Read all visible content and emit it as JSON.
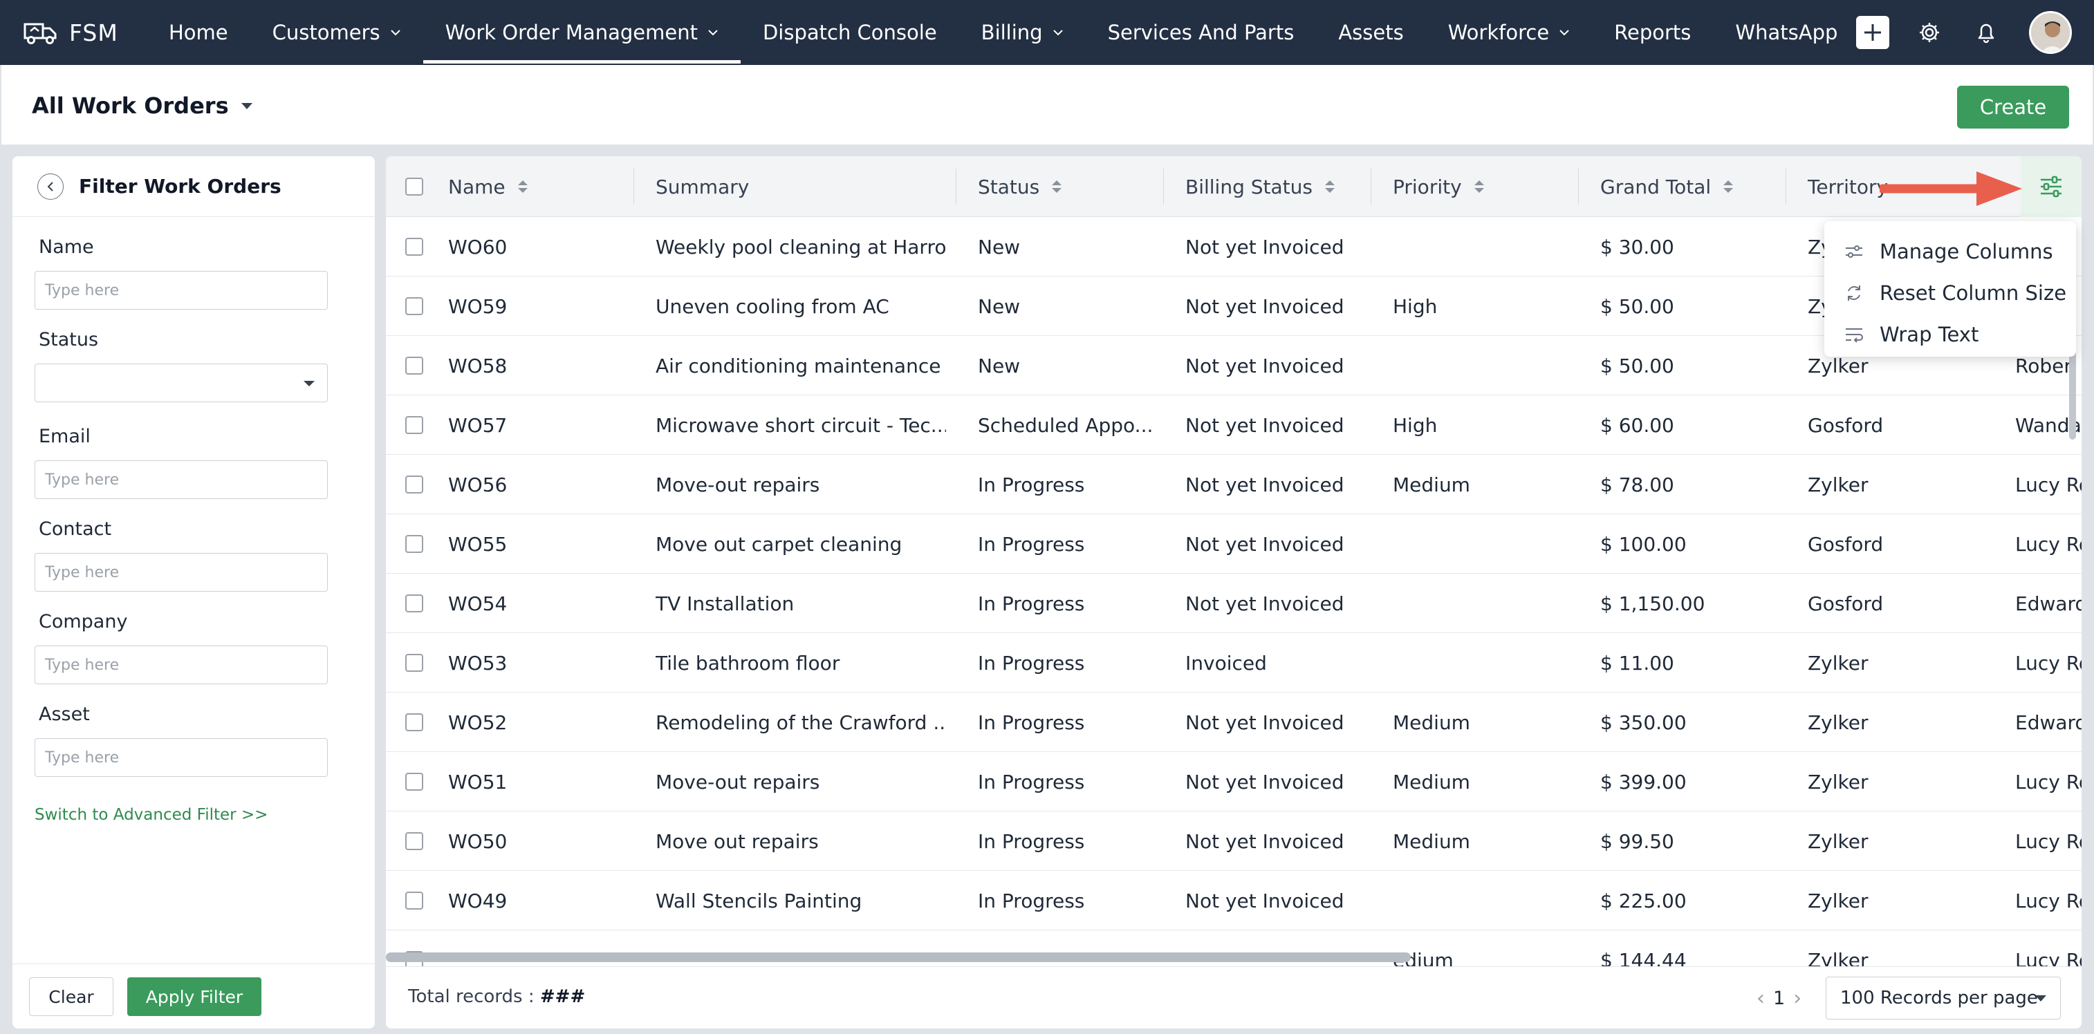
{
  "brand": {
    "name": "FSM"
  },
  "nav": [
    {
      "label": "Home",
      "dropdown": false,
      "active": false
    },
    {
      "label": "Customers",
      "dropdown": true,
      "active": false
    },
    {
      "label": "Work Order Management",
      "dropdown": true,
      "active": true
    },
    {
      "label": "Dispatch Console",
      "dropdown": false,
      "active": false
    },
    {
      "label": "Billing",
      "dropdown": true,
      "active": false
    },
    {
      "label": "Services And Parts",
      "dropdown": false,
      "active": false
    },
    {
      "label": "Assets",
      "dropdown": false,
      "active": false
    },
    {
      "label": "Workforce",
      "dropdown": true,
      "active": false
    },
    {
      "label": "Reports",
      "dropdown": false,
      "active": false
    },
    {
      "label": "WhatsApp",
      "dropdown": false,
      "active": false
    }
  ],
  "header": {
    "title": "All Work Orders",
    "create_label": "Create"
  },
  "filter": {
    "title": "Filter Work Orders",
    "fields": [
      {
        "label": "Name",
        "type": "text",
        "placeholder": "Type here"
      },
      {
        "label": "Status",
        "type": "select",
        "placeholder": ""
      },
      {
        "label": "Email",
        "type": "text",
        "placeholder": "Type here"
      },
      {
        "label": "Contact",
        "type": "text",
        "placeholder": "Type here"
      },
      {
        "label": "Company",
        "type": "text",
        "placeholder": "Type here"
      },
      {
        "label": "Asset",
        "type": "text",
        "placeholder": "Type here"
      }
    ],
    "advanced_link": "Switch to Advanced Filter >>",
    "clear_label": "Clear",
    "apply_label": "Apply Filter"
  },
  "table": {
    "columns": [
      "Name",
      "Summary",
      "Status",
      "Billing Status",
      "Priority",
      "Grand Total",
      "Territory"
    ],
    "rows": [
      [
        "WO60",
        "Weekly pool cleaning at Harro...",
        "New",
        "Not yet Invoiced",
        "",
        "$ 30.00",
        "Zy",
        ""
      ],
      [
        "WO59",
        "Uneven cooling from AC",
        "New",
        "Not yet Invoiced",
        "High",
        "$ 50.00",
        "Zy",
        ""
      ],
      [
        "WO58",
        "Air conditioning maintenance",
        "New",
        "Not yet Invoiced",
        "",
        "$ 50.00",
        "Zylker",
        "Rober"
      ],
      [
        "WO57",
        "Microwave short circuit - Tec...",
        "Scheduled Appo...",
        "Not yet Invoiced",
        "High",
        "$ 60.00",
        "Gosford",
        "Wanda"
      ],
      [
        "WO56",
        "Move-out repairs",
        "In Progress",
        "Not yet Invoiced",
        "Medium",
        "$ 78.00",
        "Zylker",
        "Lucy Ro"
      ],
      [
        "WO55",
        "Move out carpet cleaning",
        "In Progress",
        "Not yet Invoiced",
        "",
        "$ 100.00",
        "Gosford",
        "Lucy Ro"
      ],
      [
        "WO54",
        "TV Installation",
        "In Progress",
        "Not yet Invoiced",
        "",
        "$ 1,150.00",
        "Gosford",
        "Edward"
      ],
      [
        "WO53",
        "Tile bathroom floor",
        "In Progress",
        "Invoiced",
        "",
        "$ 11.00",
        "Zylker",
        "Lucy Ro"
      ],
      [
        "WO52",
        "Remodeling of the Crawford ...",
        "In Progress",
        "Not yet Invoiced",
        "Medium",
        "$ 350.00",
        "Zylker",
        "Edward"
      ],
      [
        "WO51",
        "Move-out repairs",
        "In Progress",
        "Not yet Invoiced",
        "Medium",
        "$ 399.00",
        "Zylker",
        "Lucy Ro"
      ],
      [
        "WO50",
        "Move out repairs",
        "In Progress",
        "Not yet Invoiced",
        "Medium",
        "$ 99.50",
        "Zylker",
        "Lucy Ro"
      ],
      [
        "WO49",
        "Wall Stencils Painting",
        "In Progress",
        "Not yet Invoiced",
        "",
        "$ 225.00",
        "Zylker",
        "Lucy Ro"
      ],
      [
        "",
        "",
        "",
        "",
        "edium",
        "$ 144.44",
        "Zylker",
        "Lucy Ro"
      ]
    ]
  },
  "footer": {
    "total_label": "Total records :",
    "total_value": "###",
    "page": "1",
    "per_page": "100 Records per page"
  },
  "column_menu": {
    "items": [
      {
        "label": "Manage Columns",
        "icon": "sliders-icon"
      },
      {
        "label": "Reset Column Size",
        "icon": "refresh-icon"
      },
      {
        "label": "Wrap Text",
        "icon": "wrap-text-icon"
      }
    ]
  },
  "colors": {
    "nav_bg": "#232f43",
    "accent_green": "#3a9b5c",
    "annotation_arrow": "#e8604c"
  }
}
